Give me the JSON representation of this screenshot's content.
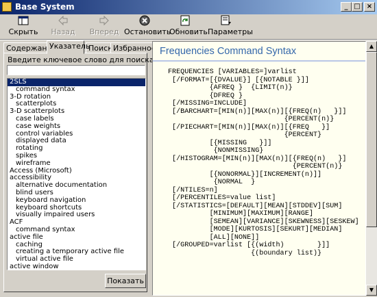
{
  "window": {
    "title": "Base System"
  },
  "toolbar": {
    "hide": "Скрыть",
    "back": "Назад",
    "forward": "Вперед",
    "stop": "Остановить",
    "refresh": "Обновить",
    "options": "Параметры"
  },
  "tabs": [
    "Содержание",
    "Указатель",
    "Поиск",
    "Избранное"
  ],
  "index": {
    "keyword_label": "Введите ключевое слово для поиска:",
    "keyword_value": "",
    "items": [
      {
        "text": "2SLS",
        "level": 0,
        "selected": true
      },
      {
        "text": "command syntax",
        "level": 1
      },
      {
        "text": "3-D rotation",
        "level": 0
      },
      {
        "text": "scatterplots",
        "level": 1
      },
      {
        "text": "3-D scatterplots",
        "level": 0
      },
      {
        "text": "case labels",
        "level": 1
      },
      {
        "text": "case weights",
        "level": 1
      },
      {
        "text": "control variables",
        "level": 1
      },
      {
        "text": "displayed data",
        "level": 1
      },
      {
        "text": "rotating",
        "level": 1
      },
      {
        "text": "spikes",
        "level": 1
      },
      {
        "text": "wireframe",
        "level": 1
      },
      {
        "text": "Access (Microsoft)",
        "level": 0
      },
      {
        "text": "accessibility",
        "level": 0
      },
      {
        "text": "alternative documentation",
        "level": 1
      },
      {
        "text": "blind users",
        "level": 1
      },
      {
        "text": "keyboard navigation",
        "level": 1
      },
      {
        "text": "keyboard shortcuts",
        "level": 1
      },
      {
        "text": "visually impaired users",
        "level": 1
      },
      {
        "text": "ACF",
        "level": 0
      },
      {
        "text": "command syntax",
        "level": 1
      },
      {
        "text": "active file",
        "level": 0
      },
      {
        "text": "caching",
        "level": 1
      },
      {
        "text": "creating a temporary active file",
        "level": 1
      },
      {
        "text": "virtual active file",
        "level": 1
      },
      {
        "text": "active window",
        "level": 0
      }
    ],
    "show_button": "Показать"
  },
  "content": {
    "title": "Frequencies Command Syntax",
    "code": "FREQUENCIES [VARIABLES=]varlist\n [/FORMAT=[{DVALUE}] [{NOTABLE }]]\n          {AFREQ }  {LIMIT(n)}\n          {DFREQ }\n [/MISSING=INCLUDE]\n [/BARCHART=[MIN(n)][MAX(n)][{FREQ(n)   }]]\n                            {PERCENT(n)}\n [/PIECHART=[MIN(n)][MAX(n)][{FREQ   }]\n                            {PERCENT}\n          [{MISSING   }]]\n           {NONMISSING}\n [/HISTOGRAM=[MIN(n)][MAX(n)][{FREQ(n)   }]\n                              {PERCENT(n)}\n          [{NONORMAL}][INCREMENT(n)]]\n           {NORMAL  }\n [/NTILES=n]\n [/PERCENTILES=value list]\n [/STATISTICS=[DEFAULT][MEAN][STDDEV][SUM]\n          [MINIMUM][MAXIMUM][RANGE]\n          [SEMEAN][VARIANCE][SKEWNESS][SESKEW]\n          [MODE][KURTOSIS][SEKURT][MEDIAN]\n          [ALL][NONE]]\n [/GROUPED=varlist [{(width)        }]]\n                    {(boundary list)}"
  },
  "colors": {
    "title_bar_start": "#0a246a",
    "title_bar_end": "#a6caf0",
    "content_bg": "#fffff0",
    "heading": "#3366aa"
  }
}
